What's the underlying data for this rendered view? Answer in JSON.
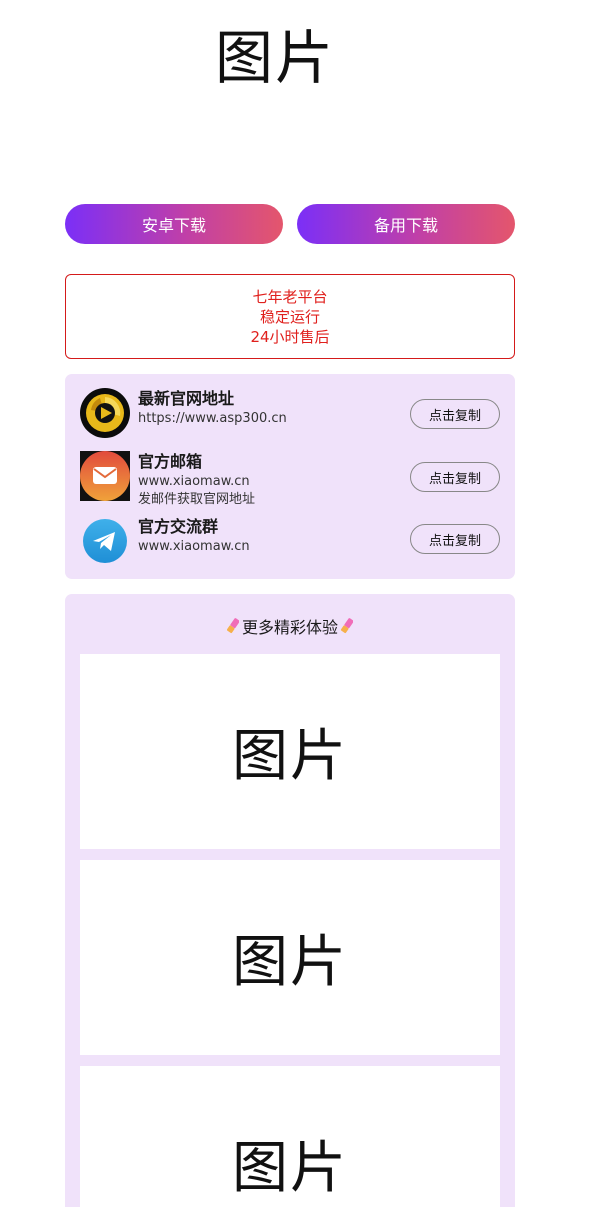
{
  "top_image": {
    "label": "图片"
  },
  "buttons": {
    "android": "安卓下载",
    "backup": "备用下载"
  },
  "notice": {
    "lines": [
      "七年老平台",
      "稳定运行",
      "24小时售后"
    ],
    "color": "#e0201d"
  },
  "contacts": [
    {
      "icon": "play-logo-icon",
      "title": "最新官网地址",
      "sub": "https://www.asp300.cn",
      "sub2": "",
      "button": "点击复制"
    },
    {
      "icon": "mail-icon",
      "title": "官方邮箱",
      "sub": "www.xiaomaw.cn",
      "sub2": "发邮件获取官网地址",
      "button": "点击复制"
    },
    {
      "icon": "telegram-icon",
      "title": "官方交流群",
      "sub": "www.xiaomaw.cn",
      "sub2": "",
      "button": "点击复制"
    }
  ],
  "more": {
    "title": "更多精彩体验",
    "images": [
      "图片",
      "图片",
      "图片"
    ]
  },
  "colors": {
    "accent_gradient_start": "#7b2ff7",
    "accent_gradient_end": "#e4566c",
    "card_bg": "#f0e2fa"
  }
}
